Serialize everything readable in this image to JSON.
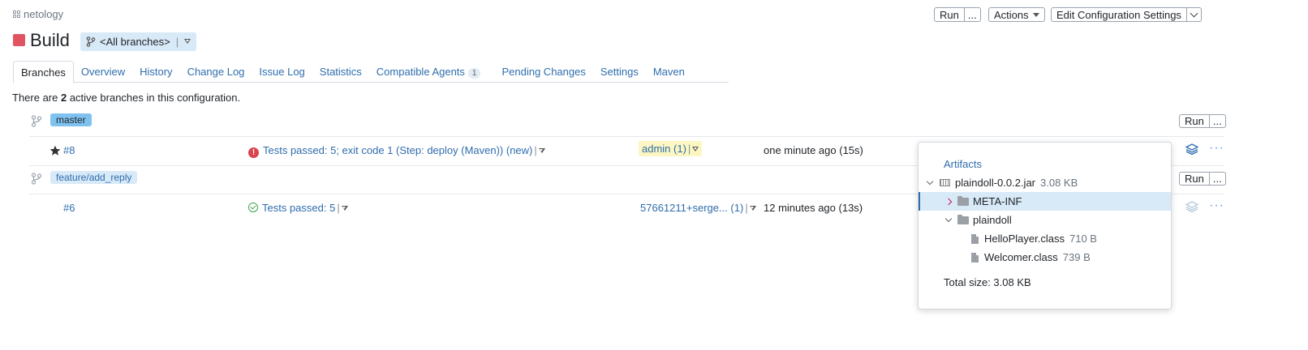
{
  "project": {
    "name": "netology"
  },
  "toolbar": {
    "run_label": "Run",
    "more_label": "...",
    "actions_label": "Actions",
    "edit_config_label": "Edit Configuration Settings"
  },
  "header": {
    "title": "Build",
    "branch_selector": "<All branches>"
  },
  "tabs": [
    {
      "label": "Branches"
    },
    {
      "label": "Overview"
    },
    {
      "label": "History"
    },
    {
      "label": "Change Log"
    },
    {
      "label": "Issue Log"
    },
    {
      "label": "Statistics"
    },
    {
      "label": "Compatible Agents",
      "badge": "1"
    },
    {
      "label": "Pending Changes"
    },
    {
      "label": "Settings"
    },
    {
      "label": "Maven"
    }
  ],
  "info": {
    "prefix": "There are ",
    "count": "2",
    "suffix": " active branches in this configuration."
  },
  "branches": [
    {
      "name": "master",
      "run_label": "Run",
      "more_label": "...",
      "build": {
        "number": "#8",
        "status": "Tests passed: 5; exit code 1 (Step: deploy (Maven)) (new)",
        "changes": "admin (1)",
        "time": "one minute ago (15s)"
      }
    },
    {
      "name": "feature/add_reply",
      "run_label": "Run",
      "more_label": "...",
      "build": {
        "number": "#6",
        "status": "Tests passed: 5",
        "changes": "57661211+serge... (1)",
        "time": "12 minutes ago (13s)"
      }
    }
  ],
  "artifacts": {
    "title": "Artifacts",
    "jar": {
      "name": "plaindoll-0.0.2.jar",
      "size": "3.08 KB"
    },
    "meta_inf": "META-INF",
    "folder": "plaindoll",
    "files": [
      {
        "name": "HelloPlayer.class",
        "size": "710 B"
      },
      {
        "name": "Welcomer.class",
        "size": "739 B"
      }
    ],
    "total_label": "Total size: ",
    "total_value": "3.08 KB"
  },
  "colors": {
    "failed": "#e05561",
    "link": "#2f6dad",
    "branch_pill": "#7fc2f0"
  }
}
